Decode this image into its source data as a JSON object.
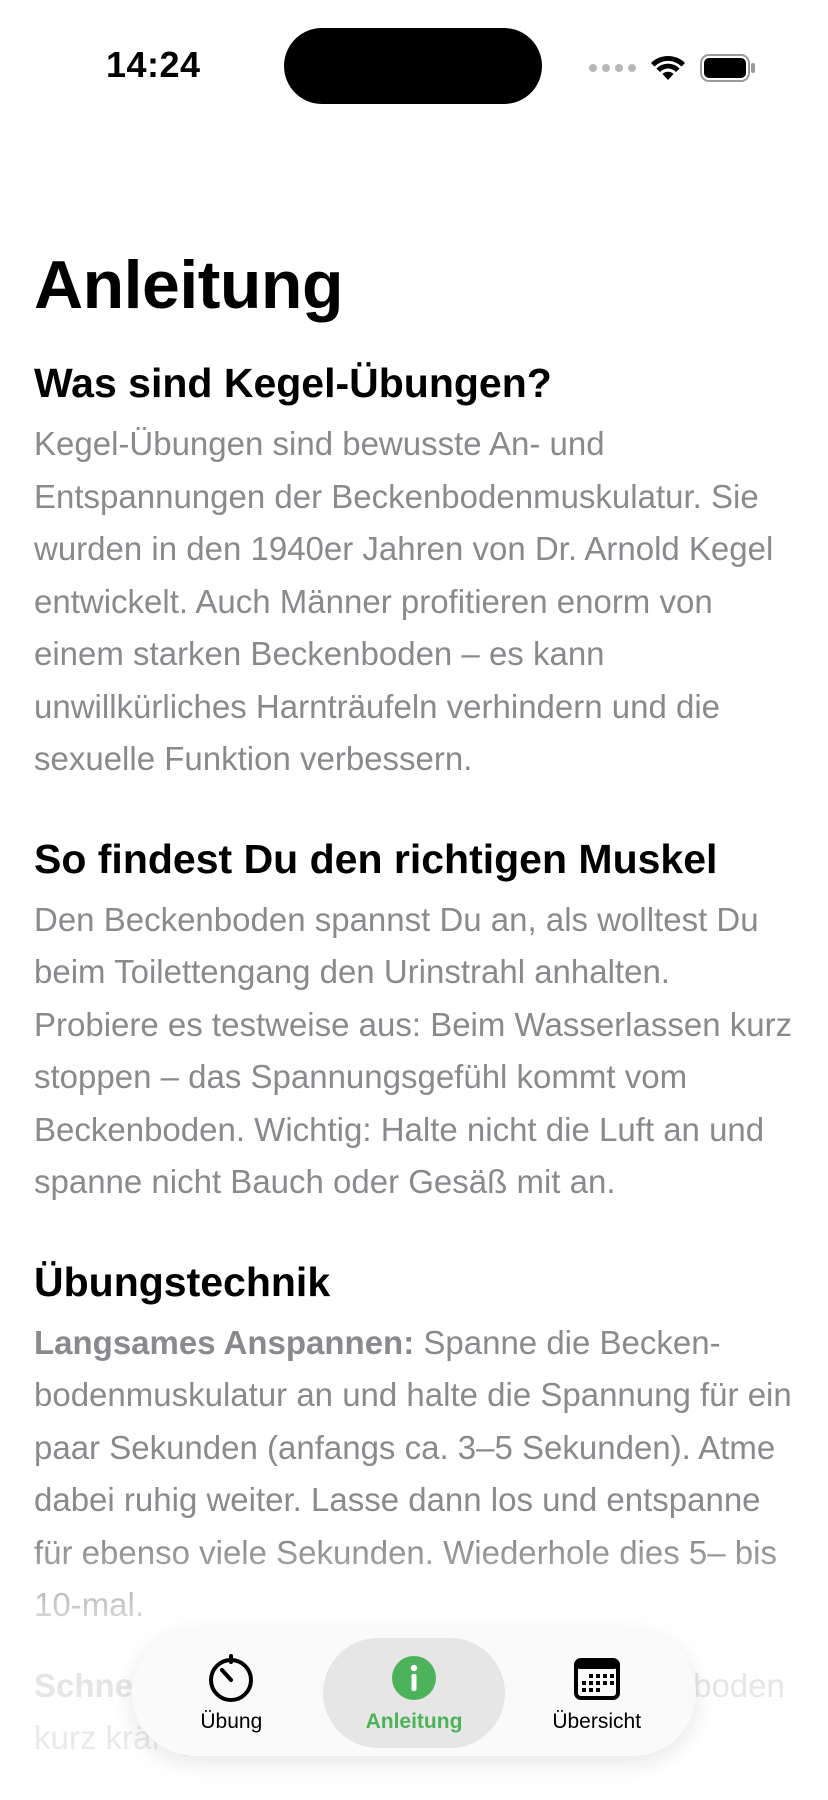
{
  "status_bar": {
    "time": "14:24"
  },
  "page": {
    "title": "Anleitung"
  },
  "sections": [
    {
      "heading": "Was sind Kegel-Übungen?",
      "body": "Kegel-Übungen sind bewusste An- und Entspannungen der Beckenbodenmuskulatur. Sie wurden in den 1940er Jahren von Dr. Arnold Kegel entwickelt. Auch Männer profitieren enorm von einem starken Beckenboden – es kann unwillkürliches Harnträufeln verhindern und die sexuelle Funktion verbessern."
    },
    {
      "heading": "So findest Du den richtigen Muskel",
      "body": "Den Beckenboden spannst Du an, als wolltest Du beim Toilettengang den Urinstrahl anhalten. Probiere es testweise aus: Beim Wasserlassen kurz stoppen – das Spannungsgefühl kommt vom Beckenboden. Wichtig: Halte nicht die Luft an und spanne nicht Bauch oder Gesäß mit an."
    },
    {
      "heading": "Übungstechnik",
      "lead_bold": "Langsames Anspannen:",
      "body": " Spanne die Becken­bodenmuskulatur an und halte die Spannung für ein paar Sekunden (anfangs ca. 3–5 Sekunden). Atme dabei ruhig weiter. Lasse dann los und entspanne für ebenso viele Sekunden. Wiederhole dies 5– bis 10-mal."
    }
  ],
  "next_paragraph": {
    "lead_bold": "Schnelles Anspannen:",
    "body": " Spanne den Becken­boden kurz kräftig an (ca. 1 Sekunde) und"
  },
  "tab_bar": {
    "tabs": [
      {
        "label": "Übung",
        "icon": "timer-icon",
        "active": false
      },
      {
        "label": "Anleitung",
        "icon": "info-icon",
        "active": true
      },
      {
        "label": "Übersicht",
        "icon": "calendar-icon",
        "active": false
      }
    ],
    "accent_color": "#4cb35a"
  }
}
